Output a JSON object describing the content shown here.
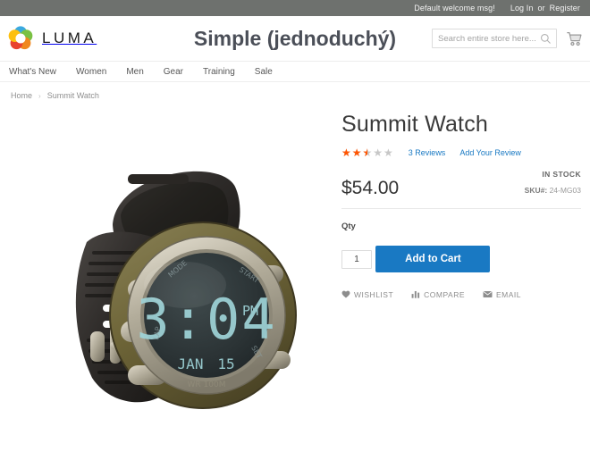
{
  "top_panel": {
    "welcome": "Default welcome msg!",
    "login": "Log In",
    "or": "or",
    "register": "Register"
  },
  "header": {
    "logo_text": "LUMA",
    "logo_icon": "luma-flower-icon",
    "store_title": "Simple (jednoduchý)",
    "search_placeholder": "Search entire store here...",
    "search_value": "",
    "search_icon": "search-icon",
    "cart_icon": "shopping-cart-icon"
  },
  "nav": {
    "items": [
      {
        "label": "What's New"
      },
      {
        "label": "Women"
      },
      {
        "label": "Men"
      },
      {
        "label": "Gear"
      },
      {
        "label": "Training"
      },
      {
        "label": "Sale"
      }
    ]
  },
  "breadcrumb": {
    "home": "Home",
    "separator": "›",
    "current": "Summit Watch"
  },
  "product": {
    "name": "Summit Watch",
    "image_alt": "Summit Watch digital sport watch with olive bezel and black strap",
    "rating": {
      "stars_filled": 2.5,
      "stars_total": 5,
      "star_glyph": "★★★★★",
      "reviews_link": "3 Reviews",
      "add_review_link": "Add Your Review",
      "filled_color": "#ff5501",
      "empty_color": "#c7c7c7"
    },
    "price": "$54.00",
    "availability": "IN STOCK",
    "sku_label": "SKU#:",
    "sku_value": "24-MG03",
    "qty_label": "Qty",
    "qty_value": "1",
    "add_to_cart_label": "Add to Cart",
    "add_to_cart_color": "#1979c3",
    "actions": [
      {
        "label": "WISHLIST",
        "icon": "heart-icon"
      },
      {
        "label": "COMPARE",
        "icon": "compare-bars-icon"
      },
      {
        "label": "EMAIL",
        "icon": "envelope-icon"
      }
    ]
  }
}
